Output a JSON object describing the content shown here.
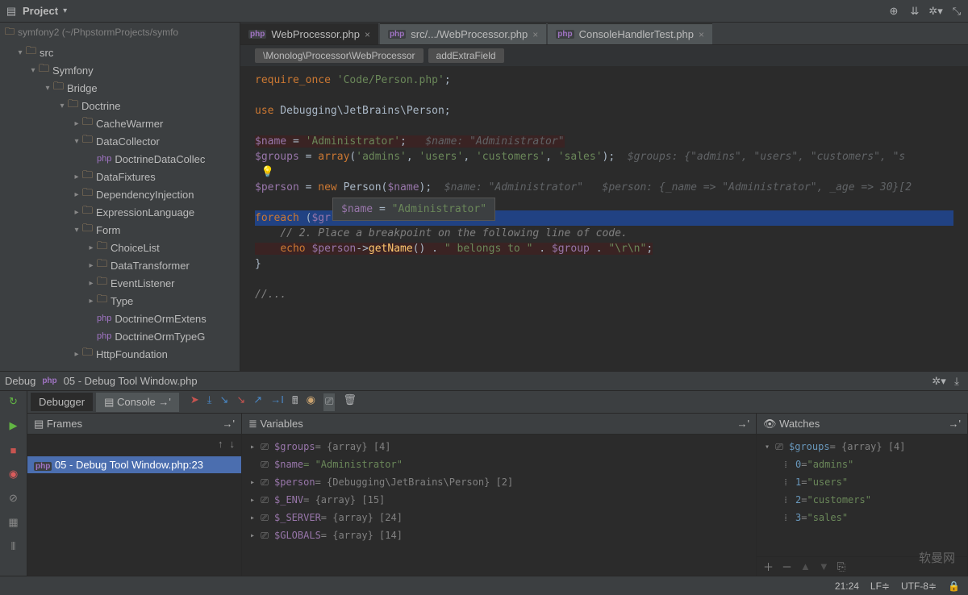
{
  "toolbar": {
    "project_label": "Project"
  },
  "breadcrumb": "symfony2 (~/PhpstormProjects/symfo",
  "tree": [
    {
      "indent": 1,
      "arrow": "▾",
      "icon": "folder",
      "label": "src"
    },
    {
      "indent": 2,
      "arrow": "▾",
      "icon": "folder",
      "label": "Symfony"
    },
    {
      "indent": 3,
      "arrow": "▾",
      "icon": "folder",
      "label": "Bridge"
    },
    {
      "indent": 4,
      "arrow": "▾",
      "icon": "folder",
      "label": "Doctrine"
    },
    {
      "indent": 5,
      "arrow": "▸",
      "icon": "folder",
      "label": "CacheWarmer"
    },
    {
      "indent": 5,
      "arrow": "▾",
      "icon": "folder",
      "label": "DataCollector"
    },
    {
      "indent": 6,
      "arrow": "",
      "icon": "file",
      "label": "DoctrineDataCollec"
    },
    {
      "indent": 5,
      "arrow": "▸",
      "icon": "folder",
      "label": "DataFixtures"
    },
    {
      "indent": 5,
      "arrow": "▸",
      "icon": "folder",
      "label": "DependencyInjection"
    },
    {
      "indent": 5,
      "arrow": "▸",
      "icon": "folder",
      "label": "ExpressionLanguage"
    },
    {
      "indent": 5,
      "arrow": "▾",
      "icon": "folder",
      "label": "Form"
    },
    {
      "indent": 6,
      "arrow": "▸",
      "icon": "folder",
      "label": "ChoiceList"
    },
    {
      "indent": 6,
      "arrow": "▸",
      "icon": "folder",
      "label": "DataTransformer"
    },
    {
      "indent": 6,
      "arrow": "▸",
      "icon": "folder",
      "label": "EventListener"
    },
    {
      "indent": 6,
      "arrow": "▸",
      "icon": "folder",
      "label": "Type"
    },
    {
      "indent": 6,
      "arrow": "",
      "icon": "file",
      "label": "DoctrineOrmExtens"
    },
    {
      "indent": 6,
      "arrow": "",
      "icon": "file",
      "label": "DoctrineOrmTypeG"
    },
    {
      "indent": 5,
      "arrow": "▸",
      "icon": "folder",
      "label": "HttpFoundation"
    }
  ],
  "tabs": [
    {
      "label": "WebProcessor.php",
      "active": true
    },
    {
      "label": "src/.../WebProcessor.php",
      "active": false
    },
    {
      "label": "ConsoleHandlerTest.php",
      "active": false
    }
  ],
  "crumb1": "\\Monolog\\Processor\\WebProcessor",
  "crumb2": "addExtraField",
  "tooltip": {
    "var": "$name",
    "eq": " = ",
    "val": "\"Administrator\""
  },
  "debug_bar": {
    "label": "Debug",
    "file": "05 - Debug Tool Window.php"
  },
  "debug_tabs": {
    "debugger": "Debugger",
    "console": "Console"
  },
  "frames": {
    "title": "Frames",
    "row": "05 - Debug Tool Window.php:23"
  },
  "variables": {
    "title": "Variables",
    "rows": [
      {
        "name": "$groups",
        "val": " = {array} [4]"
      },
      {
        "name": "$name",
        "val": " = \"Administrator\"",
        "str": true
      },
      {
        "name": "$person",
        "val": " = {Debugging\\JetBrains\\Person} [2]"
      },
      {
        "name": "$_ENV",
        "val": " = {array} [15]"
      },
      {
        "name": "$_SERVER",
        "val": " = {array} [24]"
      },
      {
        "name": "$GLOBALS",
        "val": " = {array} [14]"
      }
    ]
  },
  "watches": {
    "title": "Watches",
    "root": {
      "name": "$groups",
      "val": " = {array} [4]"
    },
    "children": [
      {
        "key": "0",
        "val": "\"admins\""
      },
      {
        "key": "1",
        "val": "\"users\""
      },
      {
        "key": "2",
        "val": "\"customers\""
      },
      {
        "key": "3",
        "val": "\"sales\""
      }
    ]
  },
  "status": {
    "pos": "21:24",
    "lf": "LF≑",
    "enc": "UTF-8≑"
  },
  "watermark": "软曼网"
}
